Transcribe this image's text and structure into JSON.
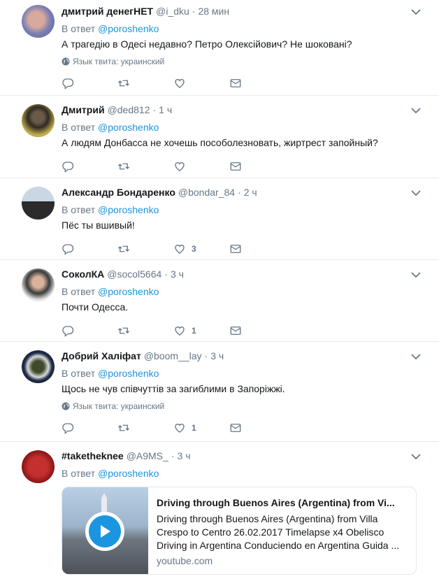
{
  "reply_prefix": "В ответ",
  "lang_label": "Язык твита: украинский",
  "colors": {
    "link": "#1b95e0",
    "muted": "#657786",
    "text": "#14171a",
    "border": "#e6ecf0"
  },
  "tweets": [
    {
      "name": "дмитрий денегНЕТ",
      "handle": "@i_dku",
      "time": "28 мин",
      "reply_to": "@poroshenko",
      "text": "А трагедію в Одесі недавно? Петро Олексійович? Не шоковані?",
      "likes": ""
    },
    {
      "name": "Дмитрий",
      "handle": "@ded812",
      "time": "1 ч",
      "reply_to": "@poroshenko",
      "text": "А людям Донбасса не хочешь пособолезновать, жиртрест запойный?",
      "likes": ""
    },
    {
      "name": "Александр Бондаренко",
      "handle": "@bondar_84",
      "time": "2 ч",
      "reply_to": "@poroshenko",
      "text": "Пёс ты вшивый!",
      "likes": "3"
    },
    {
      "name": "СоколКА",
      "handle": "@socol5664",
      "time": "3 ч",
      "reply_to": "@poroshenko",
      "text": "Почти Одесса.",
      "likes": "1"
    },
    {
      "name": "Добрий Халіфат",
      "handle": "@boom__lay",
      "time": "3 ч",
      "reply_to": "@poroshenko",
      "text": "Щось не чув співчуттів за загиблими в Запоріжжі.",
      "likes": "1"
    },
    {
      "name": "#taketheknee",
      "handle": "@A9MS_",
      "time": "3 ч",
      "reply_to": "@poroshenko"
    }
  ],
  "card": {
    "title": "Driving through Buenos Aires (Argentina) from Vi...",
    "description": "Driving through Buenos Aires (Argentina) from Villa Crespo to Centro 26.02.2017 Timelapse x4 Obelisco Driving in Argentina Conduciendo en Argentina Guida ...",
    "domain": "youtube.com"
  },
  "icons": [
    "reply-icon",
    "retweet-icon",
    "like-icon",
    "message-icon",
    "globe-icon",
    "caret-down-icon",
    "play-icon"
  ]
}
